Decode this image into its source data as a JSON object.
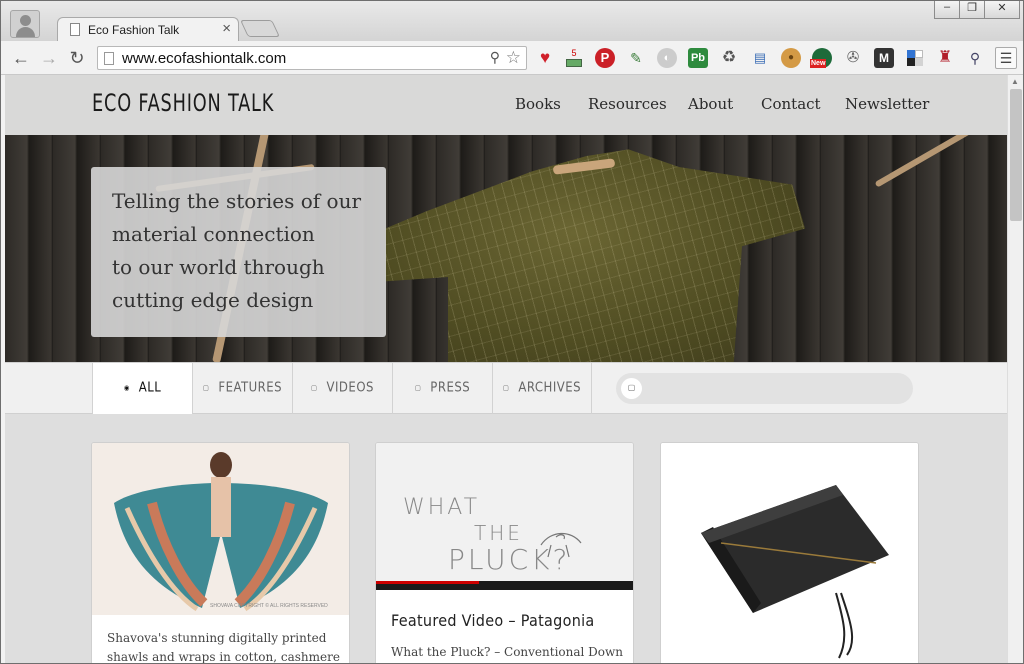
{
  "browser": {
    "tab_title": "Eco Fashion Talk",
    "tab_close": "×",
    "url": "www.ecofashiontalk.com",
    "window_controls": [
      "–",
      "❐",
      "✕"
    ],
    "ext_badge_count": "5",
    "ext_new_label": "New"
  },
  "site": {
    "logo": "ECO FASHION TALK",
    "nav": [
      "Books",
      "Resources",
      "About",
      "Contact",
      "Newsletter"
    ],
    "tagline": [
      "Telling the stories of our",
      "material connection",
      "to our world through",
      "cutting edge design"
    ]
  },
  "filters": {
    "tabs": [
      "ALL",
      "FEATURES",
      "VIDEOS",
      "PRESS",
      "ARCHIVES"
    ],
    "active": "ALL"
  },
  "cards": [
    {
      "text_lines": [
        "Shavova's stunning digitally printed",
        "shawls and wraps in cotton, cashmere"
      ],
      "image_caption": "SHOVAVA COPYRIGHT © ALL RIGHTS RESERVED"
    },
    {
      "title": "Featured Video – Patagonia",
      "text_lines": [
        "What the Pluck? – Conventional Down"
      ],
      "image_words": [
        "WHAT",
        "THE",
        "PLUCK?"
      ]
    },
    {}
  ],
  "colors": {
    "header_bg": "#d9d9d8",
    "filter_bg": "#f0f0f0",
    "page_bg": "#dedede"
  }
}
